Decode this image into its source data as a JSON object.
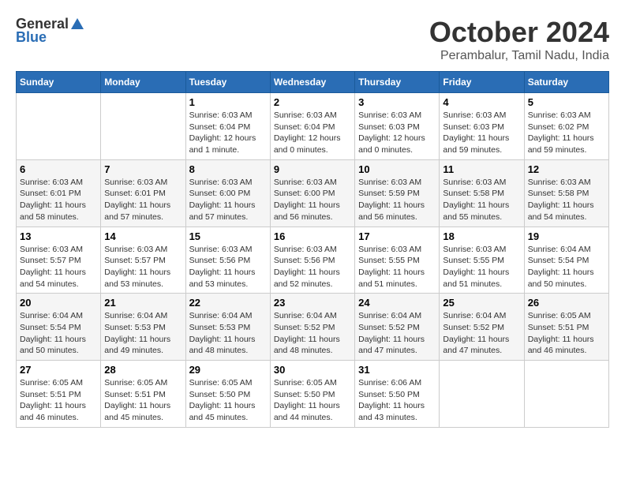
{
  "logo": {
    "general": "General",
    "blue": "Blue"
  },
  "title": {
    "month": "October 2024",
    "location": "Perambalur, Tamil Nadu, India"
  },
  "headers": [
    "Sunday",
    "Monday",
    "Tuesday",
    "Wednesday",
    "Thursday",
    "Friday",
    "Saturday"
  ],
  "weeks": [
    [
      {
        "day": "",
        "info": ""
      },
      {
        "day": "",
        "info": ""
      },
      {
        "day": "1",
        "info": "Sunrise: 6:03 AM\nSunset: 6:04 PM\nDaylight: 12 hours and 1 minute."
      },
      {
        "day": "2",
        "info": "Sunrise: 6:03 AM\nSunset: 6:04 PM\nDaylight: 12 hours and 0 minutes."
      },
      {
        "day": "3",
        "info": "Sunrise: 6:03 AM\nSunset: 6:03 PM\nDaylight: 12 hours and 0 minutes."
      },
      {
        "day": "4",
        "info": "Sunrise: 6:03 AM\nSunset: 6:03 PM\nDaylight: 11 hours and 59 minutes."
      },
      {
        "day": "5",
        "info": "Sunrise: 6:03 AM\nSunset: 6:02 PM\nDaylight: 11 hours and 59 minutes."
      }
    ],
    [
      {
        "day": "6",
        "info": "Sunrise: 6:03 AM\nSunset: 6:01 PM\nDaylight: 11 hours and 58 minutes."
      },
      {
        "day": "7",
        "info": "Sunrise: 6:03 AM\nSunset: 6:01 PM\nDaylight: 11 hours and 57 minutes."
      },
      {
        "day": "8",
        "info": "Sunrise: 6:03 AM\nSunset: 6:00 PM\nDaylight: 11 hours and 57 minutes."
      },
      {
        "day": "9",
        "info": "Sunrise: 6:03 AM\nSunset: 6:00 PM\nDaylight: 11 hours and 56 minutes."
      },
      {
        "day": "10",
        "info": "Sunrise: 6:03 AM\nSunset: 5:59 PM\nDaylight: 11 hours and 56 minutes."
      },
      {
        "day": "11",
        "info": "Sunrise: 6:03 AM\nSunset: 5:58 PM\nDaylight: 11 hours and 55 minutes."
      },
      {
        "day": "12",
        "info": "Sunrise: 6:03 AM\nSunset: 5:58 PM\nDaylight: 11 hours and 54 minutes."
      }
    ],
    [
      {
        "day": "13",
        "info": "Sunrise: 6:03 AM\nSunset: 5:57 PM\nDaylight: 11 hours and 54 minutes."
      },
      {
        "day": "14",
        "info": "Sunrise: 6:03 AM\nSunset: 5:57 PM\nDaylight: 11 hours and 53 minutes."
      },
      {
        "day": "15",
        "info": "Sunrise: 6:03 AM\nSunset: 5:56 PM\nDaylight: 11 hours and 53 minutes."
      },
      {
        "day": "16",
        "info": "Sunrise: 6:03 AM\nSunset: 5:56 PM\nDaylight: 11 hours and 52 minutes."
      },
      {
        "day": "17",
        "info": "Sunrise: 6:03 AM\nSunset: 5:55 PM\nDaylight: 11 hours and 51 minutes."
      },
      {
        "day": "18",
        "info": "Sunrise: 6:03 AM\nSunset: 5:55 PM\nDaylight: 11 hours and 51 minutes."
      },
      {
        "day": "19",
        "info": "Sunrise: 6:04 AM\nSunset: 5:54 PM\nDaylight: 11 hours and 50 minutes."
      }
    ],
    [
      {
        "day": "20",
        "info": "Sunrise: 6:04 AM\nSunset: 5:54 PM\nDaylight: 11 hours and 50 minutes."
      },
      {
        "day": "21",
        "info": "Sunrise: 6:04 AM\nSunset: 5:53 PM\nDaylight: 11 hours and 49 minutes."
      },
      {
        "day": "22",
        "info": "Sunrise: 6:04 AM\nSunset: 5:53 PM\nDaylight: 11 hours and 48 minutes."
      },
      {
        "day": "23",
        "info": "Sunrise: 6:04 AM\nSunset: 5:52 PM\nDaylight: 11 hours and 48 minutes."
      },
      {
        "day": "24",
        "info": "Sunrise: 6:04 AM\nSunset: 5:52 PM\nDaylight: 11 hours and 47 minutes."
      },
      {
        "day": "25",
        "info": "Sunrise: 6:04 AM\nSunset: 5:52 PM\nDaylight: 11 hours and 47 minutes."
      },
      {
        "day": "26",
        "info": "Sunrise: 6:05 AM\nSunset: 5:51 PM\nDaylight: 11 hours and 46 minutes."
      }
    ],
    [
      {
        "day": "27",
        "info": "Sunrise: 6:05 AM\nSunset: 5:51 PM\nDaylight: 11 hours and 46 minutes."
      },
      {
        "day": "28",
        "info": "Sunrise: 6:05 AM\nSunset: 5:51 PM\nDaylight: 11 hours and 45 minutes."
      },
      {
        "day": "29",
        "info": "Sunrise: 6:05 AM\nSunset: 5:50 PM\nDaylight: 11 hours and 45 minutes."
      },
      {
        "day": "30",
        "info": "Sunrise: 6:05 AM\nSunset: 5:50 PM\nDaylight: 11 hours and 44 minutes."
      },
      {
        "day": "31",
        "info": "Sunrise: 6:06 AM\nSunset: 5:50 PM\nDaylight: 11 hours and 43 minutes."
      },
      {
        "day": "",
        "info": ""
      },
      {
        "day": "",
        "info": ""
      }
    ]
  ]
}
